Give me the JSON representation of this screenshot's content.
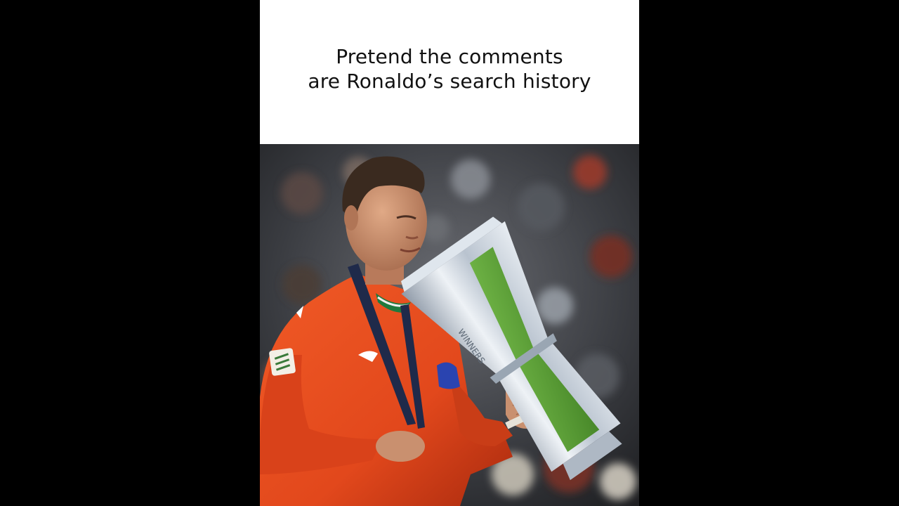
{
  "caption": {
    "line1": "Pretend the comments",
    "line2": "are Ronaldo’s search history"
  },
  "photo": {
    "subject": "footballer in orange kit holding a silver trophy in a stadium",
    "colors": {
      "jersey": "#e2481c",
      "jersey_shadow": "#a92a0e",
      "skin": "#c9906f",
      "hair": "#3a2a1f",
      "trophy_silver": "#c9d2dd",
      "trophy_green": "#5aa23a",
      "background_blur": "#3b3d42",
      "lanyard": "#1f2a4a",
      "armband": "#2a44b0"
    }
  }
}
